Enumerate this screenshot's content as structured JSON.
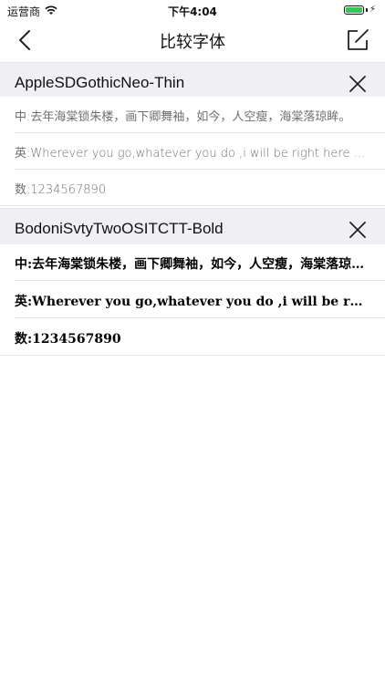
{
  "status_bar": {
    "carrier": "运营商",
    "time": "下午4:04",
    "battery_level": 1.0,
    "battery_color": "#34c759"
  },
  "nav": {
    "title": "比较字体",
    "back_icon": "chevron-left",
    "right_icon": "edit-square"
  },
  "sections": [
    {
      "font_name": "AppleSDGothicNeo-Thin",
      "rows": [
        {
          "text": "中:去年海棠锁朱楼，画下卿舞袖，如今，人空瘦，海棠落琼眸。"
        },
        {
          "text": "英:Wherever you go,whatever you do ,i will be right here waiting for you"
        },
        {
          "text": "数:1234567890"
        }
      ]
    },
    {
      "font_name": "BodoniSvtyTwoOSITCTT-Bold",
      "rows": [
        {
          "text": "中:去年海棠锁朱楼，画下卿舞袖，如今，人空瘦，海棠落琼眸。"
        },
        {
          "text": "英:Wherever you go,whatever you do ,i will be right here waiting for you"
        },
        {
          "text": "数:1234567890"
        }
      ]
    }
  ]
}
